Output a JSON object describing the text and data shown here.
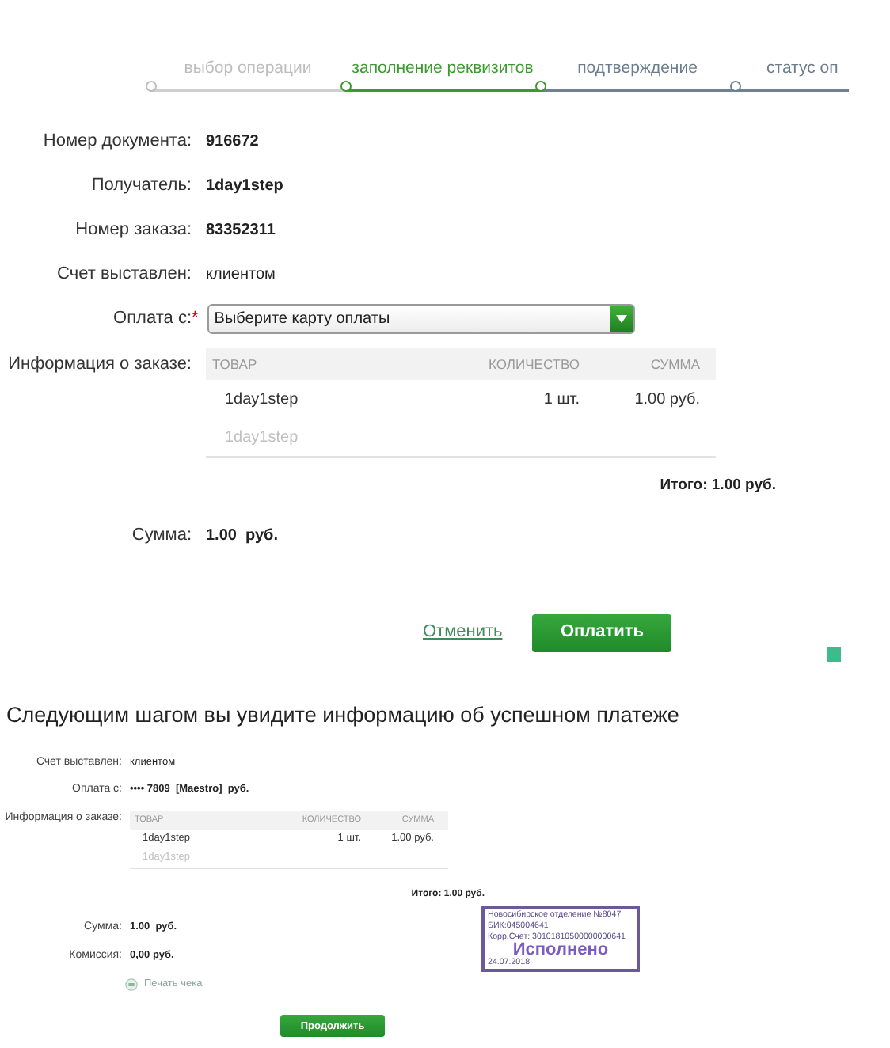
{
  "stepper": {
    "steps": [
      {
        "label": "выбор операции",
        "completed": true,
        "selected": false
      },
      {
        "label": "заполнение реквизитов",
        "completed": false,
        "selected": true
      },
      {
        "label": "подтверждение",
        "completed": false,
        "selected": false
      },
      {
        "label": "статус оп",
        "completed": false,
        "selected": false
      }
    ]
  },
  "form": {
    "fields": [
      {
        "kind": "text",
        "label": "Номер документа:",
        "value": "916672",
        "bold": true
      },
      {
        "kind": "text",
        "label": "Получатель:",
        "value": "1day1step",
        "bold": true
      },
      {
        "kind": "text",
        "label": "Номер заказа:",
        "value": "83352311",
        "bold": true
      },
      {
        "kind": "text",
        "label": "Счет выставлен:",
        "value": "клиентом",
        "bold": false
      },
      {
        "kind": "select",
        "label": "Оплата с:",
        "required_mark": "*",
        "placeholder": "Выберите карту оплаты"
      }
    ],
    "order": {
      "label": "Информация о заказе:",
      "columns": [
        "ТОВАР",
        "КОЛИЧЕСТВО",
        "СУММА"
      ],
      "rows": [
        {
          "kind": "item",
          "cells": [
            "1day1step",
            "1 шт.",
            "1.00  руб."
          ]
        },
        {
          "kind": "note",
          "cells": [
            "1day1step"
          ]
        }
      ],
      "total": "Итого: 1.00 руб."
    },
    "sum": {
      "label": "Сумма:",
      "value": "1.00  руб."
    },
    "cancel": "Отменить",
    "submit": "Оплатить"
  },
  "caption": "Следующим шагом вы увидите информацию об успешном платеже",
  "preview": {
    "fields": [
      {
        "label": "Счет выставлен:",
        "value": "клиентом",
        "bold": false
      },
      {
        "label": "Оплата с:",
        "value": "•••• 7809  [Maestro]  руб.",
        "bold": true
      }
    ],
    "order": {
      "label": "Информация о заказе:",
      "columns": [
        "ТОВАР",
        "КОЛИЧЕСТВО",
        "СУММА"
      ],
      "rows": [
        {
          "kind": "item",
          "cells": [
            "1day1step",
            "1 шт.",
            "1.00  руб."
          ]
        },
        {
          "kind": "note",
          "cells": [
            "1day1step"
          ]
        }
      ],
      "total": "Итого: 1.00 руб."
    },
    "totals": [
      {
        "label": "Сумма:",
        "value": "1.00  руб."
      },
      {
        "label": "Комиссия:",
        "value": "0,00 руб."
      }
    ],
    "print_link": "Печать чека",
    "stamp": {
      "lines": [
        "Новосибирское отделение №8047",
        "БИК:045004641",
        "Корр.Счет: 30101810500000000641"
      ],
      "status": "Исполнено",
      "date": "24.07.2018"
    },
    "button": "Продолжить"
  }
}
